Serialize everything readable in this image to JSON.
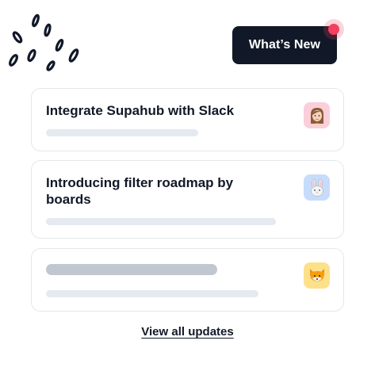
{
  "header": {
    "whats_new_label": "What’s New",
    "notification_color": "#f43f5e"
  },
  "updates": [
    {
      "title": "Integrate Supahub with Slack",
      "avatar_icon": "woman-face-icon",
      "avatar_bg": "#fbcfd9"
    },
    {
      "title": "Introducing filter roadmap by boards",
      "avatar_icon": "rabbit-face-icon",
      "avatar_bg": "#c7dcfa"
    },
    {
      "title": "",
      "avatar_icon": "fox-face-icon",
      "avatar_bg": "#fde08a"
    }
  ],
  "footer": {
    "view_all_label": "View all updates"
  },
  "colors": {
    "button_bg": "#111827",
    "skeleton_light": "#e5e9f0",
    "skeleton_dark": "#c1c7d0"
  }
}
